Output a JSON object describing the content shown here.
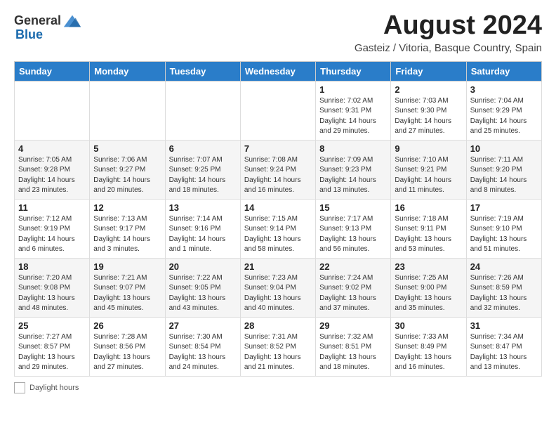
{
  "header": {
    "logo_general": "General",
    "logo_blue": "Blue",
    "title": "August 2024",
    "subtitle": "Gasteiz / Vitoria, Basque Country, Spain"
  },
  "weekdays": [
    "Sunday",
    "Monday",
    "Tuesday",
    "Wednesday",
    "Thursday",
    "Friday",
    "Saturday"
  ],
  "footer": {
    "daylight_label": "Daylight hours"
  },
  "weeks": [
    [
      {
        "day": "",
        "info": ""
      },
      {
        "day": "",
        "info": ""
      },
      {
        "day": "",
        "info": ""
      },
      {
        "day": "",
        "info": ""
      },
      {
        "day": "1",
        "info": "Sunrise: 7:02 AM\nSunset: 9:31 PM\nDaylight: 14 hours\nand 29 minutes."
      },
      {
        "day": "2",
        "info": "Sunrise: 7:03 AM\nSunset: 9:30 PM\nDaylight: 14 hours\nand 27 minutes."
      },
      {
        "day": "3",
        "info": "Sunrise: 7:04 AM\nSunset: 9:29 PM\nDaylight: 14 hours\nand 25 minutes."
      }
    ],
    [
      {
        "day": "4",
        "info": "Sunrise: 7:05 AM\nSunset: 9:28 PM\nDaylight: 14 hours\nand 23 minutes."
      },
      {
        "day": "5",
        "info": "Sunrise: 7:06 AM\nSunset: 9:27 PM\nDaylight: 14 hours\nand 20 minutes."
      },
      {
        "day": "6",
        "info": "Sunrise: 7:07 AM\nSunset: 9:25 PM\nDaylight: 14 hours\nand 18 minutes."
      },
      {
        "day": "7",
        "info": "Sunrise: 7:08 AM\nSunset: 9:24 PM\nDaylight: 14 hours\nand 16 minutes."
      },
      {
        "day": "8",
        "info": "Sunrise: 7:09 AM\nSunset: 9:23 PM\nDaylight: 14 hours\nand 13 minutes."
      },
      {
        "day": "9",
        "info": "Sunrise: 7:10 AM\nSunset: 9:21 PM\nDaylight: 14 hours\nand 11 minutes."
      },
      {
        "day": "10",
        "info": "Sunrise: 7:11 AM\nSunset: 9:20 PM\nDaylight: 14 hours\nand 8 minutes."
      }
    ],
    [
      {
        "day": "11",
        "info": "Sunrise: 7:12 AM\nSunset: 9:19 PM\nDaylight: 14 hours\nand 6 minutes."
      },
      {
        "day": "12",
        "info": "Sunrise: 7:13 AM\nSunset: 9:17 PM\nDaylight: 14 hours\nand 3 minutes."
      },
      {
        "day": "13",
        "info": "Sunrise: 7:14 AM\nSunset: 9:16 PM\nDaylight: 14 hours\nand 1 minute."
      },
      {
        "day": "14",
        "info": "Sunrise: 7:15 AM\nSunset: 9:14 PM\nDaylight: 13 hours\nand 58 minutes."
      },
      {
        "day": "15",
        "info": "Sunrise: 7:17 AM\nSunset: 9:13 PM\nDaylight: 13 hours\nand 56 minutes."
      },
      {
        "day": "16",
        "info": "Sunrise: 7:18 AM\nSunset: 9:11 PM\nDaylight: 13 hours\nand 53 minutes."
      },
      {
        "day": "17",
        "info": "Sunrise: 7:19 AM\nSunset: 9:10 PM\nDaylight: 13 hours\nand 51 minutes."
      }
    ],
    [
      {
        "day": "18",
        "info": "Sunrise: 7:20 AM\nSunset: 9:08 PM\nDaylight: 13 hours\nand 48 minutes."
      },
      {
        "day": "19",
        "info": "Sunrise: 7:21 AM\nSunset: 9:07 PM\nDaylight: 13 hours\nand 45 minutes."
      },
      {
        "day": "20",
        "info": "Sunrise: 7:22 AM\nSunset: 9:05 PM\nDaylight: 13 hours\nand 43 minutes."
      },
      {
        "day": "21",
        "info": "Sunrise: 7:23 AM\nSunset: 9:04 PM\nDaylight: 13 hours\nand 40 minutes."
      },
      {
        "day": "22",
        "info": "Sunrise: 7:24 AM\nSunset: 9:02 PM\nDaylight: 13 hours\nand 37 minutes."
      },
      {
        "day": "23",
        "info": "Sunrise: 7:25 AM\nSunset: 9:00 PM\nDaylight: 13 hours\nand 35 minutes."
      },
      {
        "day": "24",
        "info": "Sunrise: 7:26 AM\nSunset: 8:59 PM\nDaylight: 13 hours\nand 32 minutes."
      }
    ],
    [
      {
        "day": "25",
        "info": "Sunrise: 7:27 AM\nSunset: 8:57 PM\nDaylight: 13 hours\nand 29 minutes."
      },
      {
        "day": "26",
        "info": "Sunrise: 7:28 AM\nSunset: 8:56 PM\nDaylight: 13 hours\nand 27 minutes."
      },
      {
        "day": "27",
        "info": "Sunrise: 7:30 AM\nSunset: 8:54 PM\nDaylight: 13 hours\nand 24 minutes."
      },
      {
        "day": "28",
        "info": "Sunrise: 7:31 AM\nSunset: 8:52 PM\nDaylight: 13 hours\nand 21 minutes."
      },
      {
        "day": "29",
        "info": "Sunrise: 7:32 AM\nSunset: 8:51 PM\nDaylight: 13 hours\nand 18 minutes."
      },
      {
        "day": "30",
        "info": "Sunrise: 7:33 AM\nSunset: 8:49 PM\nDaylight: 13 hours\nand 16 minutes."
      },
      {
        "day": "31",
        "info": "Sunrise: 7:34 AM\nSunset: 8:47 PM\nDaylight: 13 hours\nand 13 minutes."
      }
    ]
  ]
}
